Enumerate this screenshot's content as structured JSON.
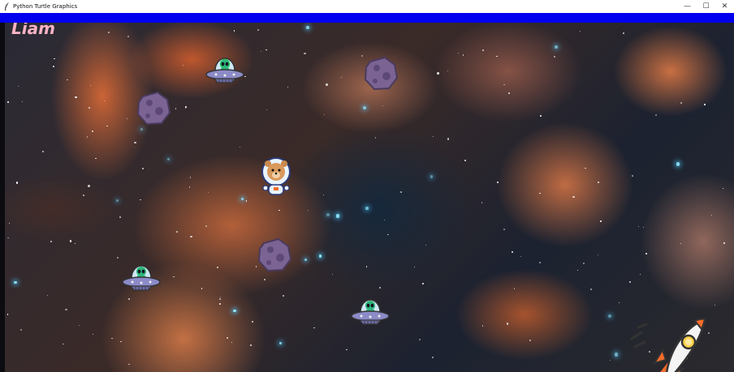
{
  "window": {
    "title": "Python Turtle Graphics",
    "controls": {
      "minimize": "—",
      "maximize": "☐",
      "close": "✕"
    }
  },
  "game": {
    "player_name": "Liam",
    "sprites": {
      "ufos": [
        "ufo-alien-icon",
        "ufo-alien-icon",
        "ufo-alien-icon"
      ],
      "asteroids": [
        "asteroid-icon",
        "asteroid-icon",
        "asteroid-icon"
      ],
      "player": "astronaut-bear-icon",
      "rocket": "rocket-icon"
    }
  },
  "colors": {
    "top_bar": "#0000ee",
    "name_text": "#f9b3c4",
    "asteroid": "#7b6494",
    "ufo_saucer": "#8c8bc8",
    "alien": "#2fb57a",
    "rocket_flame": "#f36b2a"
  }
}
